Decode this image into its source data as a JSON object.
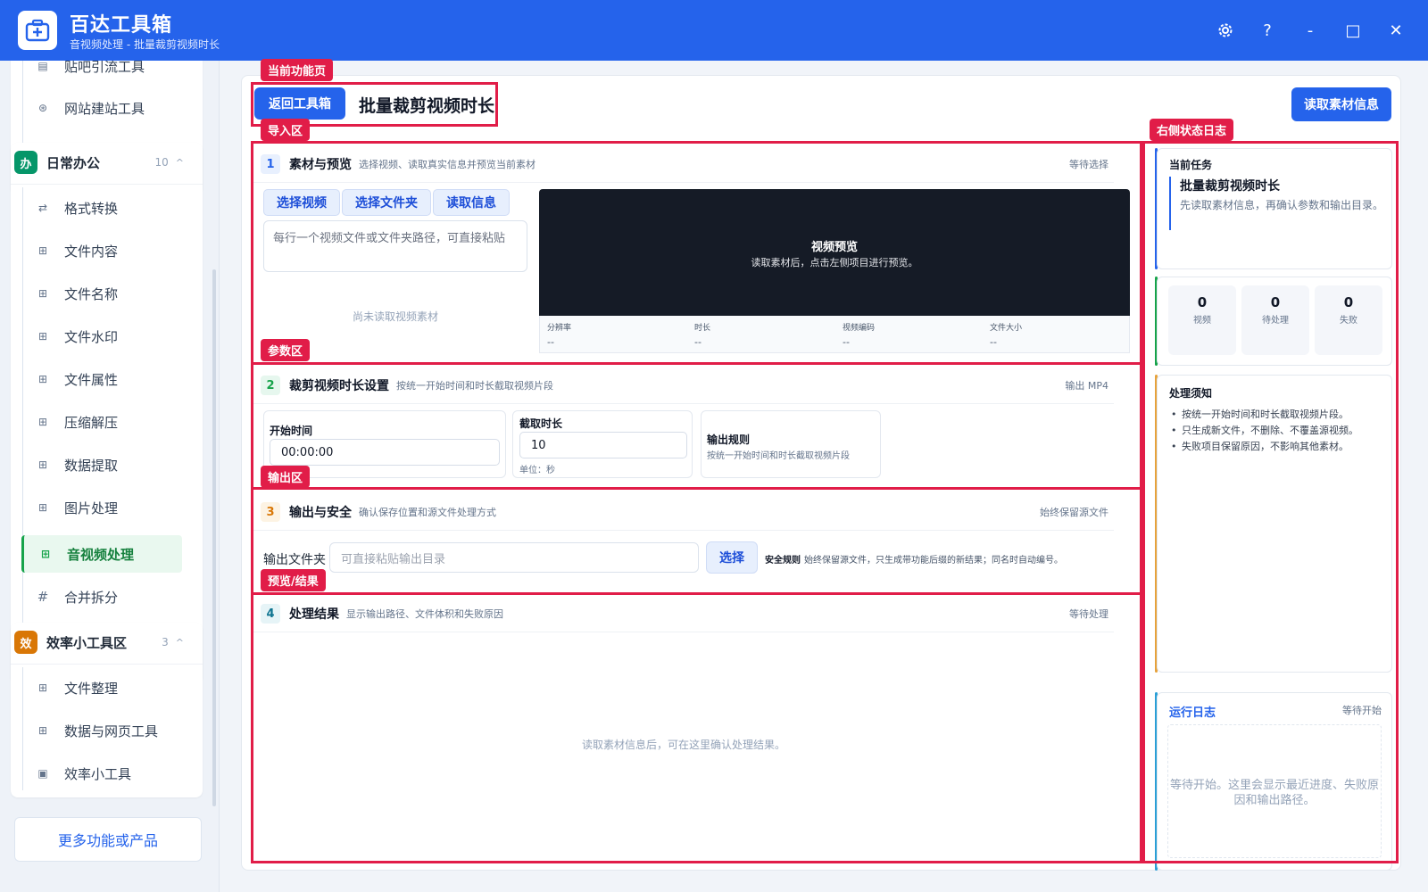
{
  "titlebar": {
    "title": "百达工具箱",
    "subtitle": "音视频处理 - 批量裁剪视频时长",
    "settings_icon": "gear-icon",
    "help_label": "?",
    "minimize_label": "-",
    "maximize_label": "□",
    "close_label": "✕"
  },
  "sidebar": {
    "top_items": [
      {
        "label": "贴吧引流工具",
        "icon": "document-icon"
      },
      {
        "label": "网站建站工具",
        "icon": "globe-icon"
      }
    ],
    "group_office": {
      "badge": "办",
      "title": "日常办公",
      "count": "10",
      "caret": "^",
      "items": [
        {
          "label": "格式转换",
          "icon": "swap-icon"
        },
        {
          "label": "文件内容",
          "icon": "grid-icon"
        },
        {
          "label": "文件名称",
          "icon": "grid-icon"
        },
        {
          "label": "文件水印",
          "icon": "grid-icon"
        },
        {
          "label": "文件属性",
          "icon": "grid-icon"
        },
        {
          "label": "压缩解压",
          "icon": "grid-icon"
        },
        {
          "label": "数据提取",
          "icon": "grid-icon"
        },
        {
          "label": "图片处理",
          "icon": "grid-icon"
        },
        {
          "label": "音视频处理",
          "icon": "grid-icon",
          "active": true
        },
        {
          "label": "合并拆分",
          "icon": "hash-icon"
        }
      ]
    },
    "group_eff": {
      "badge": "效",
      "title": "效率小工具区",
      "count": "3",
      "caret": "^",
      "items": [
        {
          "label": "文件整理",
          "icon": "grid-icon"
        },
        {
          "label": "数据与网页工具",
          "icon": "grid-icon"
        },
        {
          "label": "效率小工具",
          "icon": "toolbox-icon"
        }
      ]
    },
    "more_label": "更多功能或产品"
  },
  "header": {
    "back_label": "返回工具箱",
    "page_title": "批量裁剪视频时长",
    "read_info_label": "读取素材信息"
  },
  "annotations": {
    "current_page": "当前功能页",
    "import_zone": "导入区",
    "param_zone": "参数区",
    "output_zone": "输出区",
    "preview_zone": "预览/结果",
    "right_log": "右侧状态日志"
  },
  "section1": {
    "num": "1",
    "title": "素材与预览",
    "desc": "选择视频、读取真实信息并预览当前素材",
    "status": "等待选择",
    "btn_video": "选择视频",
    "btn_folder": "选择文件夹",
    "btn_read": "读取信息",
    "textarea_placeholder": "每行一个视频文件或文件夹路径，可直接粘贴",
    "empty_note": "尚未读取视频素材",
    "preview_title": "视频预览",
    "preview_sub": "读取素材后，点击左侧项目进行预览。",
    "meta": [
      {
        "label": "分辨率",
        "value": "--"
      },
      {
        "label": "时长",
        "value": "--"
      },
      {
        "label": "视频编码",
        "value": "--"
      },
      {
        "label": "文件大小",
        "value": "--"
      }
    ]
  },
  "section2": {
    "num": "2",
    "title": "裁剪视频时长设置",
    "desc": "按统一开始时间和时长截取视频片段",
    "status": "输出 MP4",
    "start_label": "开始时间",
    "start_value": "00:00:00",
    "duration_label": "截取时长",
    "duration_value": "10",
    "unit_hint": "单位：秒",
    "rule_title": "输出规则",
    "rule_desc": "按统一开始时间和时长截取视频片段"
  },
  "section3": {
    "num": "3",
    "title": "输出与安全",
    "desc": "确认保存位置和源文件处理方式",
    "status": "始终保留源文件",
    "folder_label": "输出文件夹",
    "folder_placeholder": "可直接粘贴输出目录",
    "choose_label": "选择",
    "safety_title": "安全规则",
    "safety_desc": "始终保留源文件，只生成带功能后缀的新结果；同名时自动编号。"
  },
  "section4": {
    "num": "4",
    "title": "处理结果",
    "desc": "显示输出路径、文件体积和失败原因",
    "status": "等待处理",
    "empty_note": "读取素材信息后，可在这里确认处理结果。"
  },
  "right_panel": {
    "task_label": "当前任务",
    "task_title": "批量裁剪视频时长",
    "task_desc": "先读取素材信息，再确认参数和输出目录。",
    "stats": [
      {
        "num": "0",
        "label": "视频"
      },
      {
        "num": "0",
        "label": "待处理"
      },
      {
        "num": "0",
        "label": "失败"
      }
    ],
    "notice_title": "处理须知",
    "notices": [
      "按统一开始时间和时长截取视频片段。",
      "只生成新文件，不删除、不覆盖源视频。",
      "失败项目保留原因，不影响其他素材。"
    ],
    "log_title": "运行日志",
    "log_status": "等待开始",
    "log_empty": "等待开始。这里会显示最近进度、失败原因和输出路径。"
  },
  "colors": {
    "primary": "#2563eb",
    "annotation": "#e11d48",
    "active_green": "#16a34a",
    "office_badge": "#059669",
    "eff_badge": "#d97706"
  }
}
